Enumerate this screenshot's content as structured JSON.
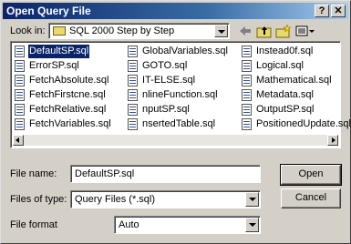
{
  "window": {
    "title": "Open Query File",
    "help_glyph": "?",
    "close_glyph": "✕"
  },
  "lookin": {
    "label": "Look in:",
    "value": "SQL 2000 Step by Step"
  },
  "toolbar_icons": [
    "back-arrow-icon",
    "up-one-level-icon",
    "create-new-folder-icon",
    "view-menu-icon"
  ],
  "files": [
    [
      "DefaultSP.sql",
      "ErrorSP.sql",
      "FetchAbsolute.sql",
      "FetchFirstcne.sql",
      "FetchRelative.sql",
      "FetchVariables.sql"
    ],
    [
      "GlobalVariables.sql",
      "GOTO.sql",
      "IT-ELSE.sql",
      "nlineFunction.sql",
      "nputSP.sql",
      "nsertedTable.sql"
    ],
    [
      "Instead0f.sql",
      "Logical.sql",
      "Mathematical.sql",
      "Metadata.sql",
      "OutputSP.sql",
      "PositionedUpdate.sql"
    ]
  ],
  "selected_file": "DefaultSP.sql",
  "filename": {
    "label": "File name:",
    "value": "DefaultSP.sql"
  },
  "filetype": {
    "label": "Files of type:",
    "value": "Query Files (*.sql)"
  },
  "fileformat": {
    "label": "File format",
    "value": "Auto"
  },
  "buttons": {
    "open": "Open",
    "cancel": "Cancel"
  }
}
